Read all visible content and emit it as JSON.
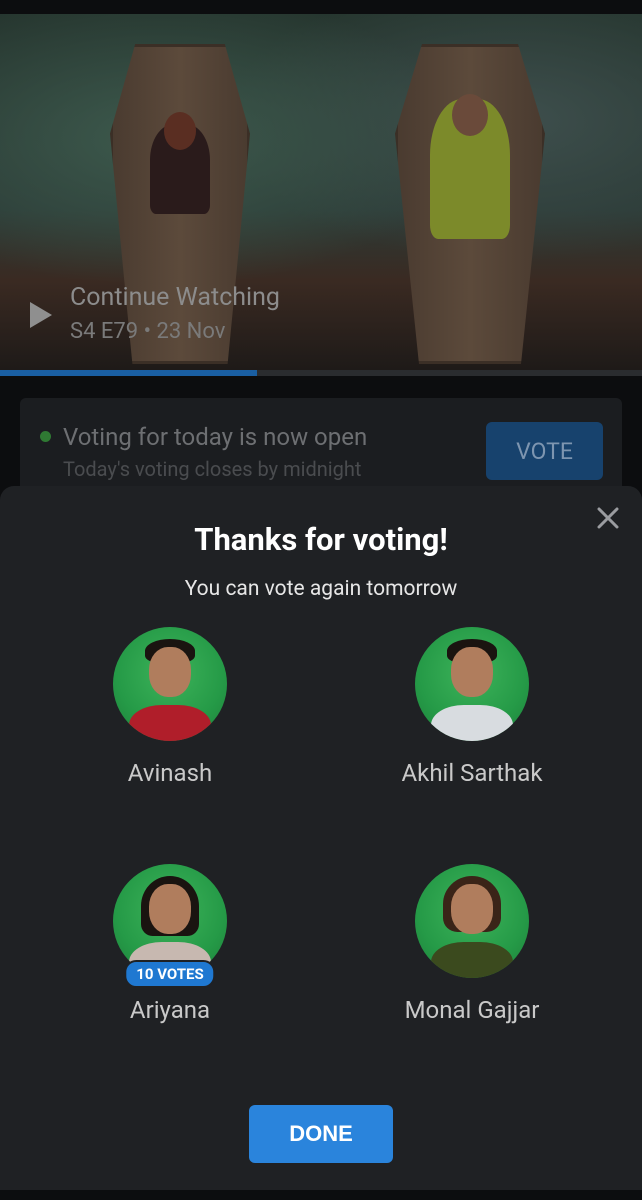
{
  "continue_watching": {
    "title": "Continue Watching",
    "subtitle": "S4 E79 • 23 Nov",
    "progress": 0.4
  },
  "voting_card": {
    "title": "Voting for today is now open",
    "subtitle": "Today's voting closes by midnight",
    "vote_button": "VOTE"
  },
  "sheet": {
    "title": "Thanks for voting!",
    "subtitle": "You can vote again tomorrow",
    "done_button": "DONE"
  },
  "contestants": [
    {
      "name": "Avinash",
      "votes": ""
    },
    {
      "name": "Akhil Sarthak",
      "votes": ""
    },
    {
      "name": "Ariyana",
      "votes": "10 VOTES"
    },
    {
      "name": "Monal Gajjar",
      "votes": ""
    }
  ],
  "colors": {
    "accent": "#2a84dc",
    "sheet_bg": "#1f2124",
    "avatar_bg": "#259a47",
    "status_dot": "#2f7a33"
  },
  "icons": {
    "play": "play-icon",
    "close": "close-icon",
    "status": "status-dot-icon"
  }
}
